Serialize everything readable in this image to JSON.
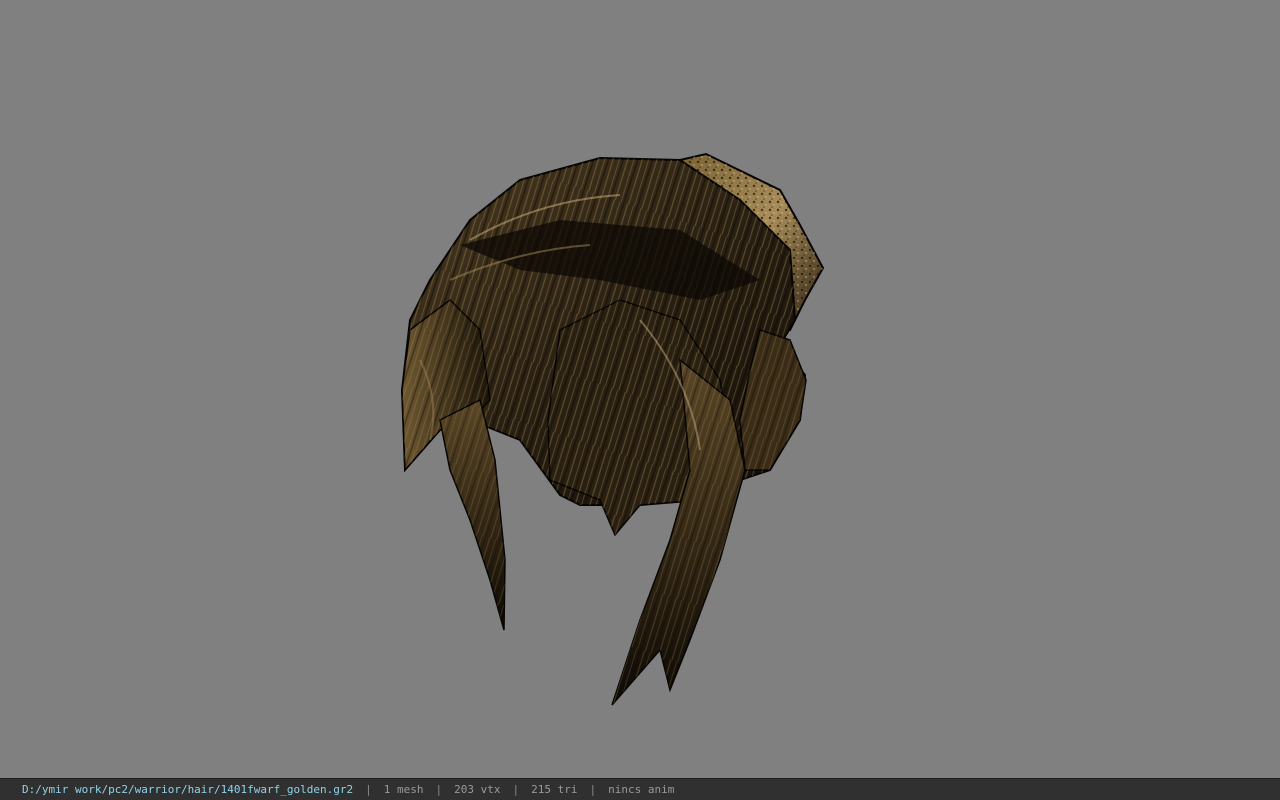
{
  "viewport": {
    "background_color": "#808080",
    "model_description_icon": "hair-mesh",
    "model_colors": {
      "dark": "#120d06",
      "mid": "#3e2f19",
      "light": "#8a7448",
      "highlight": "#c2aa78",
      "outline": "#050402"
    }
  },
  "status_bar": {
    "file_path": "D:/ymir work/pc2/warrior/hair/1401fwarf_golden.gr2",
    "separator": "|",
    "mesh_count": "1 mesh",
    "vertex_count": "203 vtx",
    "triangle_count": "215 tri",
    "animation": "nincs anim"
  }
}
